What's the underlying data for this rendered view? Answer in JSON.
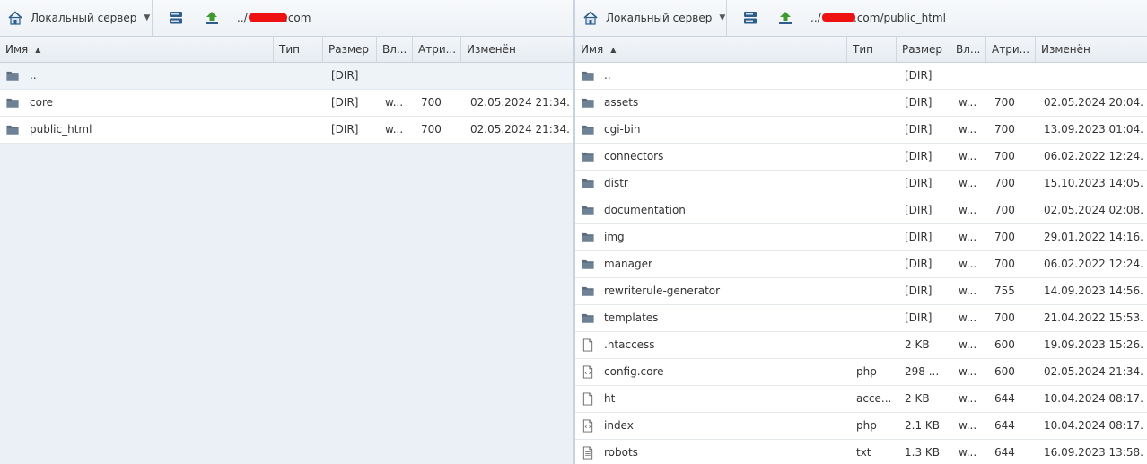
{
  "left": {
    "server_label": "Локальный сервер",
    "path_prefix": "../",
    "path_suffix": ".com",
    "columns": {
      "name": "Имя",
      "type": "Тип",
      "size": "Размер",
      "owner": "Вл...",
      "attr": "Атри...",
      "modified": "Изменён"
    },
    "rows": [
      {
        "name": "..",
        "type": "",
        "size": "[DIR]",
        "owner": "",
        "attr": "",
        "modified": "",
        "icon": "folder-icon"
      },
      {
        "name": "core",
        "type": "",
        "size": "[DIR]",
        "owner": "w...",
        "attr": "700",
        "modified": "02.05.2024 21:34...",
        "icon": "folder-icon"
      },
      {
        "name": "public_html",
        "type": "",
        "size": "[DIR]",
        "owner": "w...",
        "attr": "700",
        "modified": "02.05.2024 21:34...",
        "icon": "folder-icon"
      }
    ]
  },
  "right": {
    "server_label": "Локальный сервер",
    "path_prefix": "../",
    "path_suffix": ".com/public_html",
    "columns": {
      "name": "Имя",
      "type": "Тип",
      "size": "Размер",
      "owner": "Вл...",
      "attr": "Атри...",
      "modified": "Изменён"
    },
    "rows": [
      {
        "name": "..",
        "type": "",
        "size": "[DIR]",
        "owner": "",
        "attr": "",
        "modified": "",
        "icon": "folder-icon"
      },
      {
        "name": "assets",
        "type": "",
        "size": "[DIR]",
        "owner": "w...",
        "attr": "700",
        "modified": "02.05.2024 20:04...",
        "icon": "folder-icon"
      },
      {
        "name": "cgi-bin",
        "type": "",
        "size": "[DIR]",
        "owner": "w...",
        "attr": "700",
        "modified": "13.09.2023 01:04...",
        "icon": "folder-icon"
      },
      {
        "name": "connectors",
        "type": "",
        "size": "[DIR]",
        "owner": "w...",
        "attr": "700",
        "modified": "06.02.2022 12:24...",
        "icon": "folder-icon"
      },
      {
        "name": "distr",
        "type": "",
        "size": "[DIR]",
        "owner": "w...",
        "attr": "700",
        "modified": "15.10.2023 14:05...",
        "icon": "folder-icon"
      },
      {
        "name": "documentation",
        "type": "",
        "size": "[DIR]",
        "owner": "w...",
        "attr": "700",
        "modified": "02.05.2024 02:08...",
        "icon": "folder-icon"
      },
      {
        "name": "img",
        "type": "",
        "size": "[DIR]",
        "owner": "w...",
        "attr": "700",
        "modified": "29.01.2022 14:16...",
        "icon": "folder-icon"
      },
      {
        "name": "manager",
        "type": "",
        "size": "[DIR]",
        "owner": "w...",
        "attr": "700",
        "modified": "06.02.2022 12:24...",
        "icon": "folder-icon"
      },
      {
        "name": "rewriterule-generator",
        "type": "",
        "size": "[DIR]",
        "owner": "w...",
        "attr": "755",
        "modified": "14.09.2023 14:56...",
        "icon": "folder-icon"
      },
      {
        "name": "templates",
        "type": "",
        "size": "[DIR]",
        "owner": "w...",
        "attr": "700",
        "modified": "21.04.2022 15:53...",
        "icon": "folder-icon"
      },
      {
        "name": ".htaccess",
        "type": "",
        "size": "2 KB",
        "owner": "w...",
        "attr": "600",
        "modified": "19.09.2023 15:26...",
        "icon": "file-icon"
      },
      {
        "name": "config.core",
        "type": "php",
        "size": "298 ...",
        "owner": "w...",
        "attr": "600",
        "modified": "02.05.2024 21:34...",
        "icon": "code-file-icon"
      },
      {
        "name": "ht",
        "type": "acce...",
        "size": "2 KB",
        "owner": "w...",
        "attr": "644",
        "modified": "10.04.2024 08:17...",
        "icon": "file-icon"
      },
      {
        "name": "index",
        "type": "php",
        "size": "2.1 KB",
        "owner": "w...",
        "attr": "644",
        "modified": "10.04.2024 08:17...",
        "icon": "code-file-icon"
      },
      {
        "name": "robots",
        "type": "txt",
        "size": "1.3 KB",
        "owner": "w...",
        "attr": "644",
        "modified": "16.09.2023 13:58...",
        "icon": "text-file-icon"
      }
    ]
  },
  "colors": {
    "redaction": "#ee1111",
    "panel_bg_left": "#eaf0f6",
    "icon_blue": "#2f5d8a",
    "upload_green": "#3c9a2e"
  }
}
